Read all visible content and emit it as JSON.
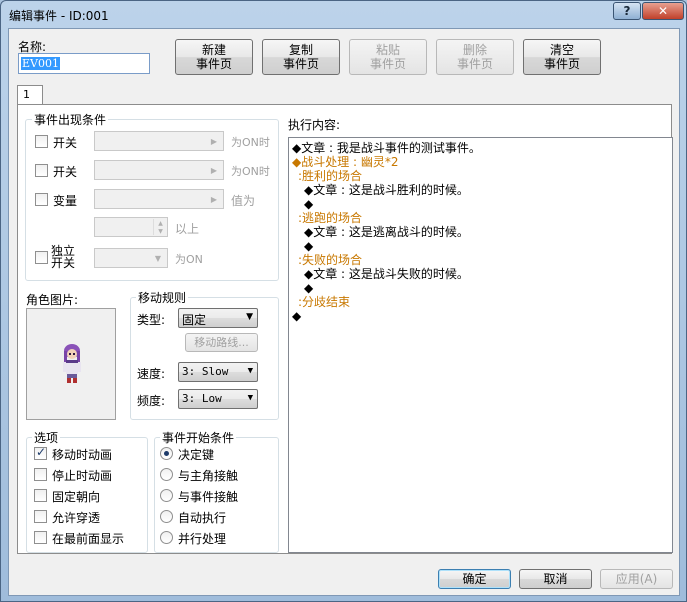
{
  "window": {
    "title": "编辑事件 - ID:001",
    "help_label": "?",
    "close_label": "✕"
  },
  "name": {
    "label": "名称:",
    "value": "EV001"
  },
  "toolbar": {
    "new_page": [
      "新建",
      "事件页"
    ],
    "copy_page": [
      "复制",
      "事件页"
    ],
    "paste_page": [
      "粘贴",
      "事件页"
    ],
    "delete_page": [
      "删除",
      "事件页"
    ],
    "clear_page": [
      "清空",
      "事件页"
    ]
  },
  "tabs": [
    {
      "label": "1"
    }
  ],
  "conditions": {
    "title": "事件出现条件",
    "switch1": {
      "label": "开关",
      "suffix": "为ON时"
    },
    "switch2": {
      "label": "开关",
      "suffix": "为ON时"
    },
    "variable": {
      "label": "变量",
      "suffix": "值为",
      "above": "以上"
    },
    "self_switch": {
      "label_line1": "独立",
      "label_line2": "开关",
      "suffix": "为ON"
    }
  },
  "graphic": {
    "title": "角色图片:"
  },
  "movement": {
    "title": "移动规则",
    "type_label": "类型:",
    "type_value": "固定",
    "route_button": "移动路线...",
    "speed_label": "速度:",
    "speed_value": "3: Slow",
    "freq_label": "频度:",
    "freq_value": "3: Low"
  },
  "options": {
    "title": "选项",
    "items": [
      {
        "label": "移动时动画",
        "checked": true
      },
      {
        "label": "停止时动画",
        "checked": false
      },
      {
        "label": "固定朝向",
        "checked": false
      },
      {
        "label": "允许穿透",
        "checked": false
      },
      {
        "label": "在最前面显示",
        "checked": false
      }
    ]
  },
  "trigger": {
    "title": "事件开始条件",
    "items": [
      {
        "label": "决定键",
        "selected": true
      },
      {
        "label": "与主角接触",
        "selected": false
      },
      {
        "label": "与事件接触",
        "selected": false
      },
      {
        "label": "自动执行",
        "selected": false
      },
      {
        "label": "并行处理",
        "selected": false
      }
    ]
  },
  "contents": {
    "title": "执行内容:",
    "lines": [
      {
        "text": "◆文章 : 我是战斗事件的测试事件。",
        "color": "#000000",
        "indent": 0
      },
      {
        "text": "◆战斗处理 : 幽灵*2",
        "color": "#c87800",
        "indent": 0
      },
      {
        "text": ":胜利的场合",
        "color": "#c87800",
        "indent": 1
      },
      {
        "text": "◆文章 : 这是战斗胜利的时候。",
        "color": "#000000",
        "indent": 2
      },
      {
        "text": "◆",
        "color": "#000000",
        "indent": 2
      },
      {
        "text": ":逃跑的场合",
        "color": "#c87800",
        "indent": 1
      },
      {
        "text": "◆文章 : 这是逃离战斗的时候。",
        "color": "#000000",
        "indent": 2
      },
      {
        "text": "◆",
        "color": "#000000",
        "indent": 2
      },
      {
        "text": ":失败的场合",
        "color": "#c87800",
        "indent": 1
      },
      {
        "text": "◆文章 : 这是战斗失败的时候。",
        "color": "#000000",
        "indent": 2
      },
      {
        "text": "◆",
        "color": "#000000",
        "indent": 2
      },
      {
        "text": ":分歧结束",
        "color": "#c87800",
        "indent": 1
      },
      {
        "text": "◆",
        "color": "#000000",
        "indent": 0
      }
    ]
  },
  "footer": {
    "ok": "确定",
    "cancel": "取消",
    "apply": "应用(A)"
  }
}
